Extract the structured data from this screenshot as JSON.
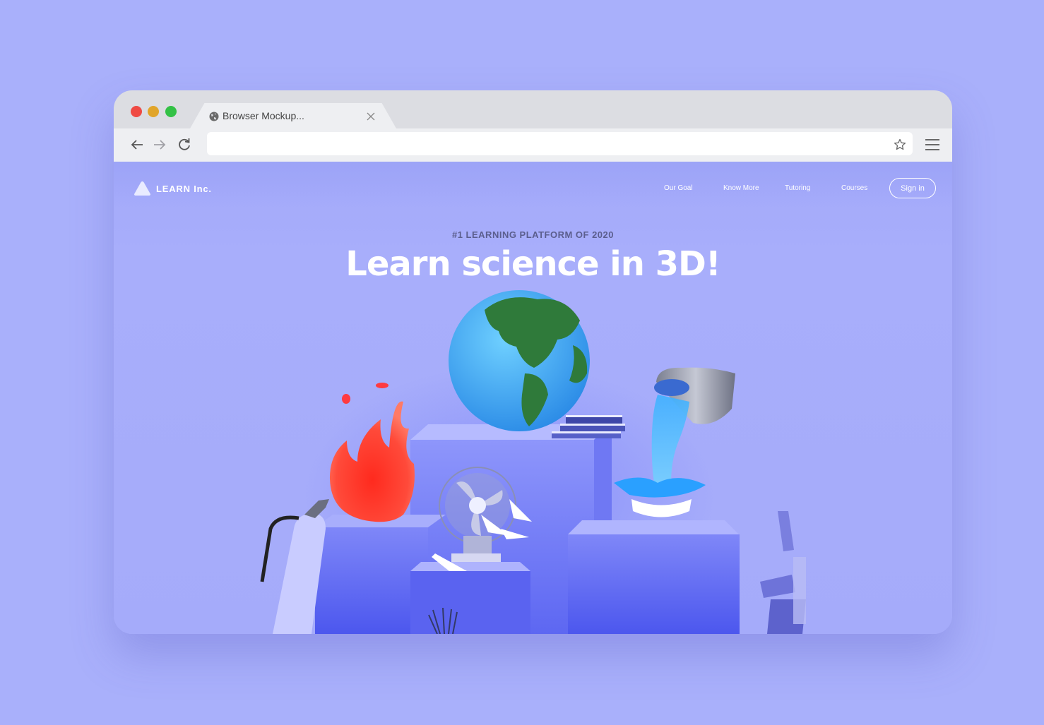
{
  "browser": {
    "tab_title": "Browser Mockup...",
    "address_placeholder": "",
    "icons": [
      "globe-icon",
      "close-icon",
      "back-arrow-icon",
      "forward-arrow-icon",
      "reload-icon",
      "star-icon",
      "hamburger-menu-icon"
    ]
  },
  "site": {
    "logo_text": "LEARN Inc.",
    "nav": [
      "Our Goal",
      "Know More",
      "Tutoring",
      "Courses"
    ],
    "signin_label": "Sign in",
    "eyebrow": "#1 LEARNING PLATFORM OF 2020",
    "headline": "Learn science in 3D!"
  },
  "colors": {
    "page_background": "#a9b0fb",
    "site_background": "#a7adfb",
    "accent_text": "#5b5e8d",
    "traffic_red": "#ef4a44",
    "traffic_yellow": "#e1a52a",
    "traffic_green": "#33c146"
  }
}
